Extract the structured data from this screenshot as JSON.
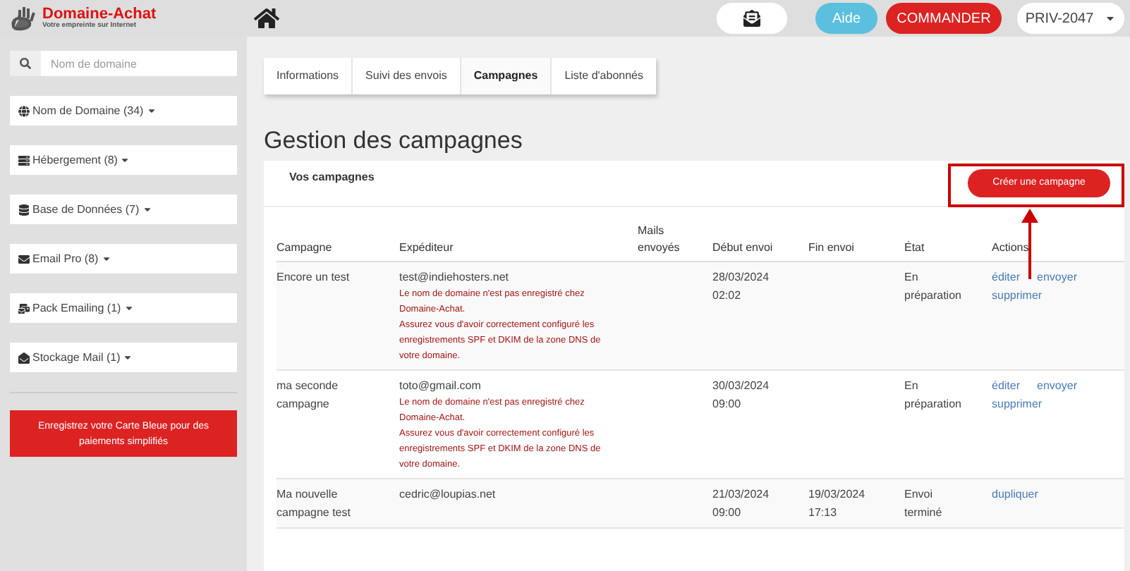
{
  "logo": {
    "name": "Domaine-Achat",
    "tagline": "Votre empreinte sur Internet"
  },
  "header_buttons": [
    {
      "kind": "mail"
    },
    {
      "kind": "help",
      "label": "Aide"
    },
    {
      "kind": "order",
      "label": "COMMANDER"
    },
    {
      "kind": "account",
      "label": "PRIV-2047"
    }
  ],
  "sidebar": {
    "search": {
      "placeholder": "Nom de domaine"
    },
    "items": [
      {
        "label": "Nom de Domaine (34)"
      },
      {
        "label": "Hébergement (8)"
      },
      {
        "label": "Base de Données (7)"
      },
      {
        "label": "Email Pro (8)"
      },
      {
        "label": "Pack Emailing (1)"
      },
      {
        "label": "Stockage Mail (1)"
      }
    ],
    "promo": "Enregistrez votre Carte Bleue pour des paiements simplifiés"
  },
  "tabs": [
    {
      "label": "Informations",
      "selected": false
    },
    {
      "label": "Suivi des envois",
      "selected": false
    },
    {
      "label": "Campagnes",
      "selected": true
    },
    {
      "label": "Liste d'abonnés",
      "selected": false
    }
  ],
  "page_title": "Gestion des campagnes",
  "panel": {
    "title": "Vos campagnes",
    "create_button": "Créer une campagne"
  },
  "table": {
    "columns": [
      "Campagne",
      "Expéditeur",
      "Mails envoyés",
      "Début envoi",
      "Fin envoi",
      "État",
      "Actions"
    ],
    "rows": [
      {
        "campagne": "Encore un test",
        "expediteur": "test@indiehosters.net",
        "warnings": [
          "Le nom de domaine n'est pas enregistré chez Domaine-Achat.",
          "Assurez vous d'avoir correctement configuré les enregistrements SPF et DKIM de la zone DNS de votre domaine."
        ],
        "debut": "28/03/2024 02:02",
        "etat": "En préparation",
        "actions": [
          "éditer",
          "envoyer",
          "supprimer"
        ]
      },
      {
        "campagne": "ma seconde campagne",
        "expediteur": "toto@gmail.com",
        "warnings": [
          "Le nom de domaine n'est pas enregistré chez Domaine-Achat.",
          "Assurez vous d'avoir correctement configuré les enregistrements SPF et DKIM de la zone DNS de votre domaine."
        ],
        "debut": "30/03/2024 09:00",
        "etat": "En préparation",
        "actions": [
          "éditer",
          "envoyer",
          "supprimer"
        ]
      },
      {
        "campagne": "Ma nouvelle campagne test",
        "expediteur": "cedric@loupias.net",
        "debut": "21/03/2024 09:00",
        "fin": "19/03/2024 17:13",
        "etat": "Envoi terminé",
        "actions": [
          "dupliquer"
        ]
      }
    ]
  }
}
